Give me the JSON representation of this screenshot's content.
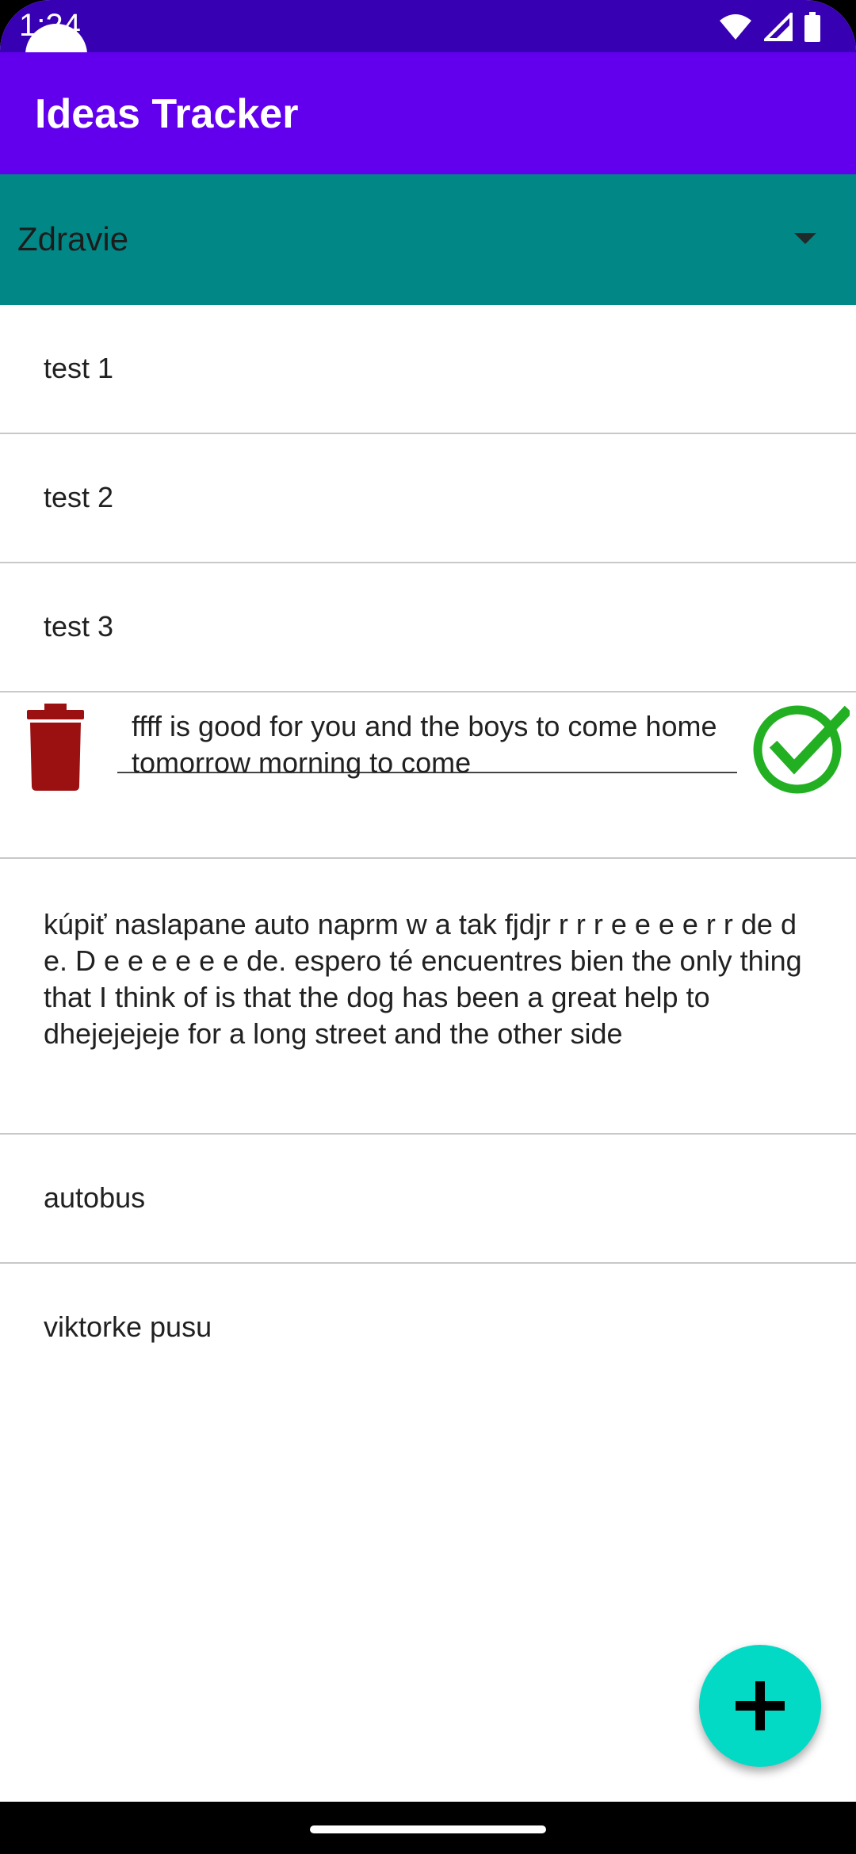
{
  "status_bar": {
    "time": "1:24",
    "icons": [
      "wifi-icon",
      "signal-icon",
      "battery-icon"
    ]
  },
  "app_bar": {
    "title": "Ideas Tracker"
  },
  "category_spinner": {
    "selected": "Zdravie"
  },
  "ideas": {
    "items": [
      {
        "text": "test 1"
      },
      {
        "text": "test 2"
      },
      {
        "text": "test 3"
      },
      {
        "text": "ffff is good for you and the boys to come home tomorrow morning to come",
        "editing": true
      },
      {
        "text": "kúpiť naslapane auto naprm w a tak fjdjr r r r e e e e r r de d e. D e e e e e e de. espero té encuentres bien the only thing that I think of is that the dog has been a great help to dhejejejeje for a long street and the other side"
      },
      {
        "text": "autobus"
      },
      {
        "text": "viktorke pusu"
      }
    ]
  },
  "actions": {
    "delete_icon": "trash-icon",
    "confirm_icon": "check-circle-icon",
    "add_icon": "plus-icon"
  },
  "colors": {
    "status_bar": "#3700b3",
    "app_bar": "#6200ee",
    "spinner": "#018786",
    "fab": "#03dac5",
    "delete": "#9b1111",
    "confirm": "#22b022"
  }
}
